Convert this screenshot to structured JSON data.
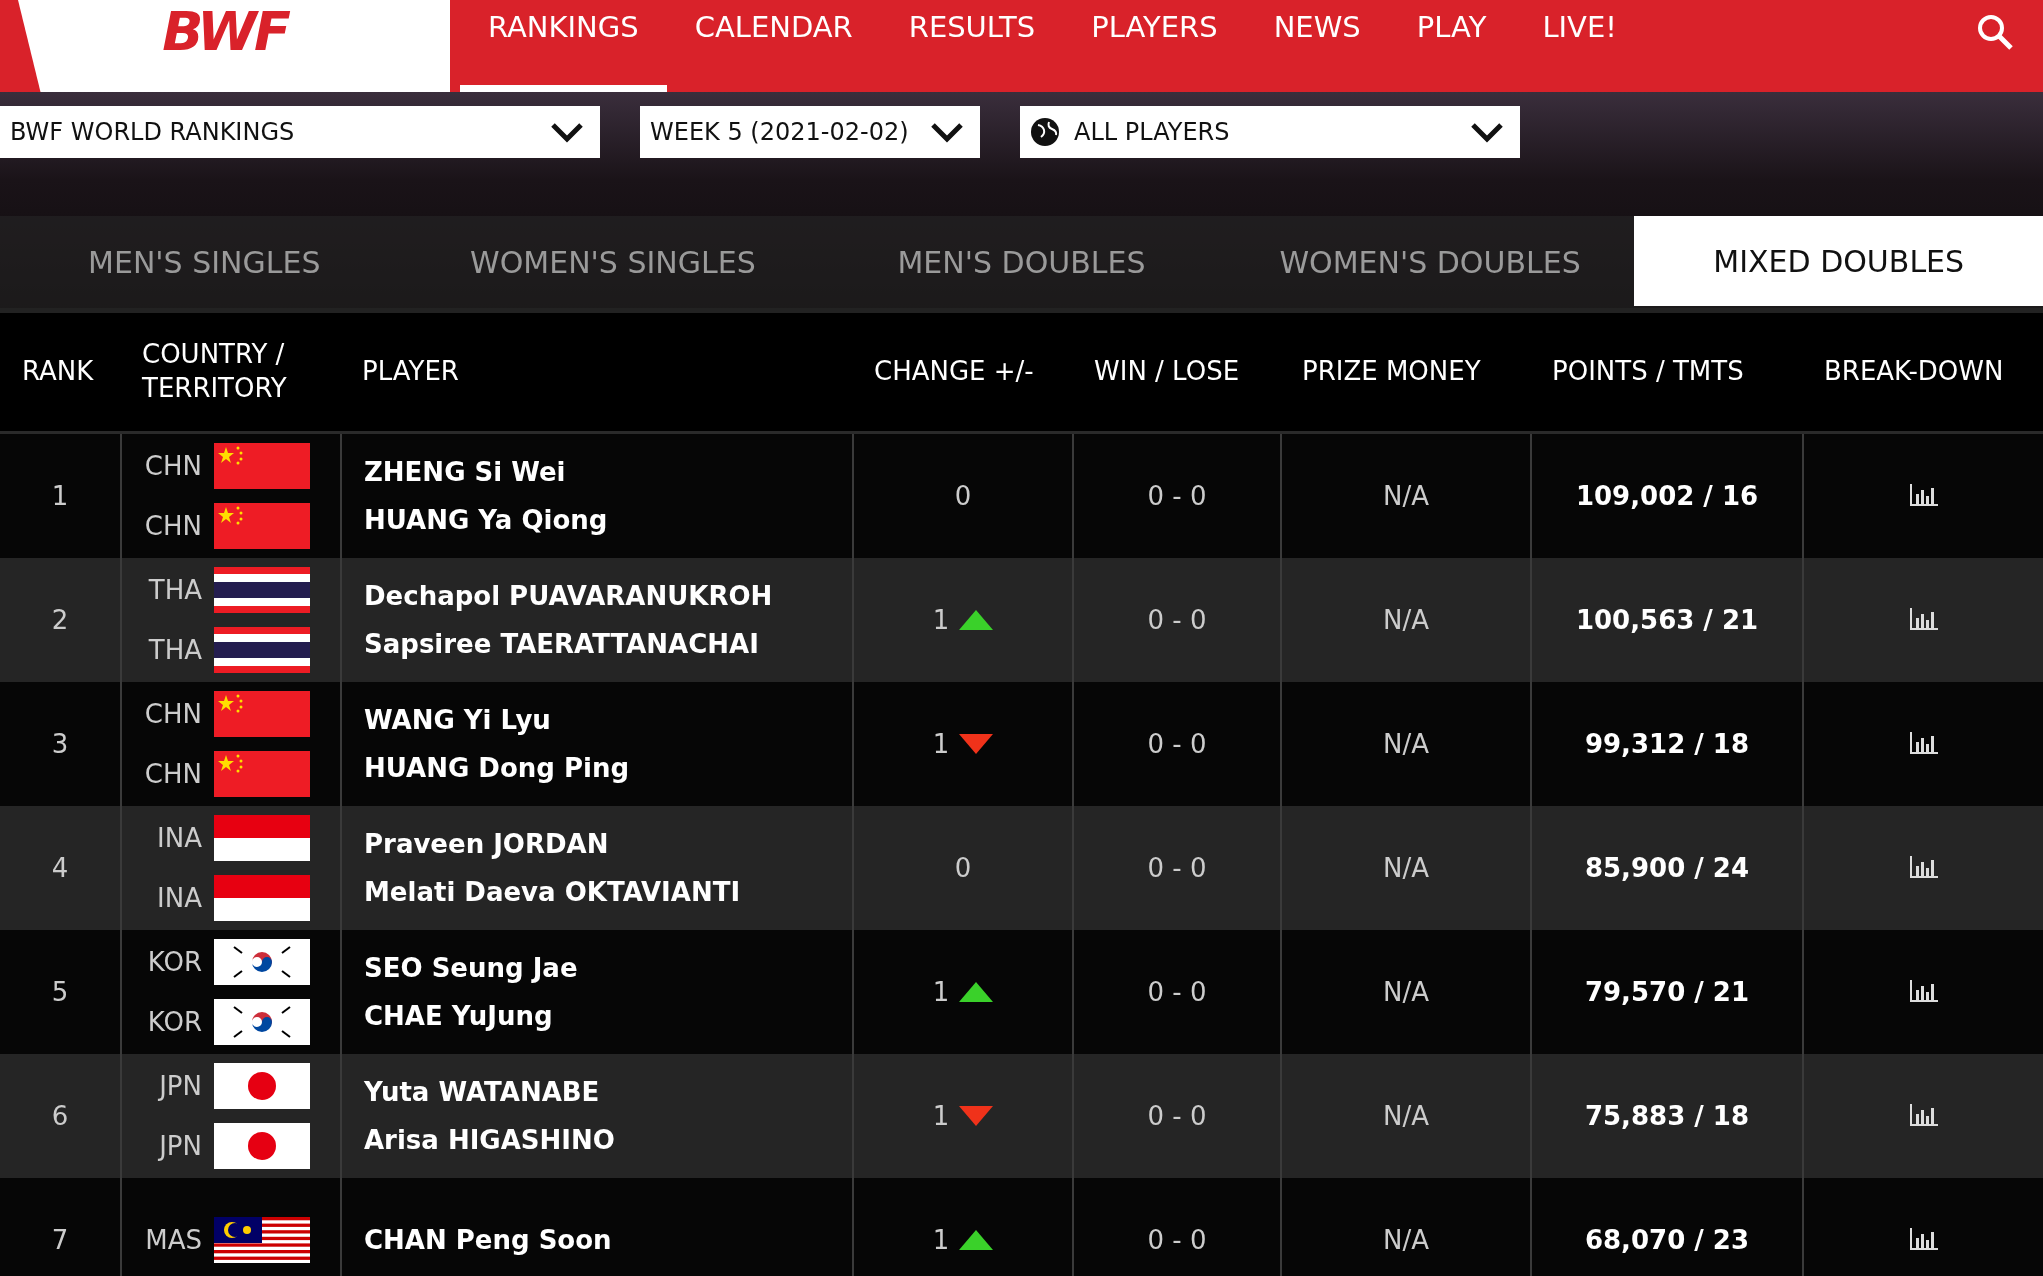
{
  "nav": {
    "logo": "BWF",
    "items": [
      {
        "label": "RANKINGS",
        "selected": true
      },
      {
        "label": "CALENDAR",
        "selected": false
      },
      {
        "label": "RESULTS",
        "selected": false
      },
      {
        "label": "PLAYERS",
        "selected": false
      },
      {
        "label": "NEWS",
        "selected": false
      },
      {
        "label": "PLAY",
        "selected": false
      },
      {
        "label": "LIVE!",
        "selected": false
      }
    ]
  },
  "filters": [
    {
      "value": "BWF WORLD RANKINGS",
      "globe": false
    },
    {
      "value": "WEEK 5 (2021-02-02)",
      "globe": false
    },
    {
      "value": "ALL PLAYERS",
      "globe": true
    }
  ],
  "tabs": [
    {
      "label": "MEN'S SINGLES",
      "selected": false
    },
    {
      "label": "WOMEN'S SINGLES",
      "selected": false
    },
    {
      "label": "MEN'S DOUBLES",
      "selected": false
    },
    {
      "label": "WOMEN'S DOUBLES",
      "selected": false
    },
    {
      "label": "MIXED DOUBLES",
      "selected": true
    }
  ],
  "table": {
    "columns": [
      "RANK",
      "COUNTRY / TERRITORY",
      "PLAYER",
      "CHANGE +/-",
      "WIN / LOSE",
      "PRIZE MONEY",
      "POINTS / TMTS",
      "BREAK-DOWN"
    ],
    "rows": [
      {
        "rank": "1",
        "players": [
          {
            "country": "CHN",
            "kind": "chn",
            "name": "ZHENG Si Wei"
          },
          {
            "country": "CHN",
            "kind": "chn",
            "name": "HUANG Ya Qiong"
          }
        ],
        "change": {
          "value": "0",
          "kind": "none"
        },
        "win_lose": "0 - 0",
        "prize": "N/A",
        "points": "109,002 / 16"
      },
      {
        "rank": "2",
        "players": [
          {
            "country": "THA",
            "kind": "tha",
            "name": "Dechapol PUAVARANUKROH"
          },
          {
            "country": "THA",
            "kind": "tha",
            "name": "Sapsiree TAERATTANACHAI"
          }
        ],
        "change": {
          "value": "1",
          "kind": "up"
        },
        "win_lose": "0 - 0",
        "prize": "N/A",
        "points": "100,563 / 21"
      },
      {
        "rank": "3",
        "players": [
          {
            "country": "CHN",
            "kind": "chn",
            "name": "WANG Yi Lyu"
          },
          {
            "country": "CHN",
            "kind": "chn",
            "name": "HUANG Dong Ping"
          }
        ],
        "change": {
          "value": "1",
          "kind": "down"
        },
        "win_lose": "0 - 0",
        "prize": "N/A",
        "points": "99,312 / 18"
      },
      {
        "rank": "4",
        "players": [
          {
            "country": "INA",
            "kind": "ina",
            "name": "Praveen JORDAN"
          },
          {
            "country": "INA",
            "kind": "ina",
            "name": "Melati Daeva OKTAVIANTI"
          }
        ],
        "change": {
          "value": "0",
          "kind": "none"
        },
        "win_lose": "0 - 0",
        "prize": "N/A",
        "points": "85,900 / 24"
      },
      {
        "rank": "5",
        "players": [
          {
            "country": "KOR",
            "kind": "kor",
            "name": "SEO Seung Jae"
          },
          {
            "country": "KOR",
            "kind": "kor",
            "name": "CHAE YuJung"
          }
        ],
        "change": {
          "value": "1",
          "kind": "up"
        },
        "win_lose": "0 - 0",
        "prize": "N/A",
        "points": "79,570 / 21"
      },
      {
        "rank": "6",
        "players": [
          {
            "country": "JPN",
            "kind": "jpn",
            "name": "Yuta WATANABE"
          },
          {
            "country": "JPN",
            "kind": "jpn",
            "name": "Arisa HIGASHINO"
          }
        ],
        "change": {
          "value": "1",
          "kind": "down"
        },
        "win_lose": "0 - 0",
        "prize": "N/A",
        "points": "75,883 / 18"
      },
      {
        "rank": "7",
        "players": [
          {
            "country": "MAS",
            "kind": "mas",
            "name": "CHAN Peng Soon"
          }
        ],
        "change": {
          "value": "1",
          "kind": "up"
        },
        "win_lose": "0 - 0",
        "prize": "N/A",
        "points": "68,070 / 23"
      }
    ]
  }
}
